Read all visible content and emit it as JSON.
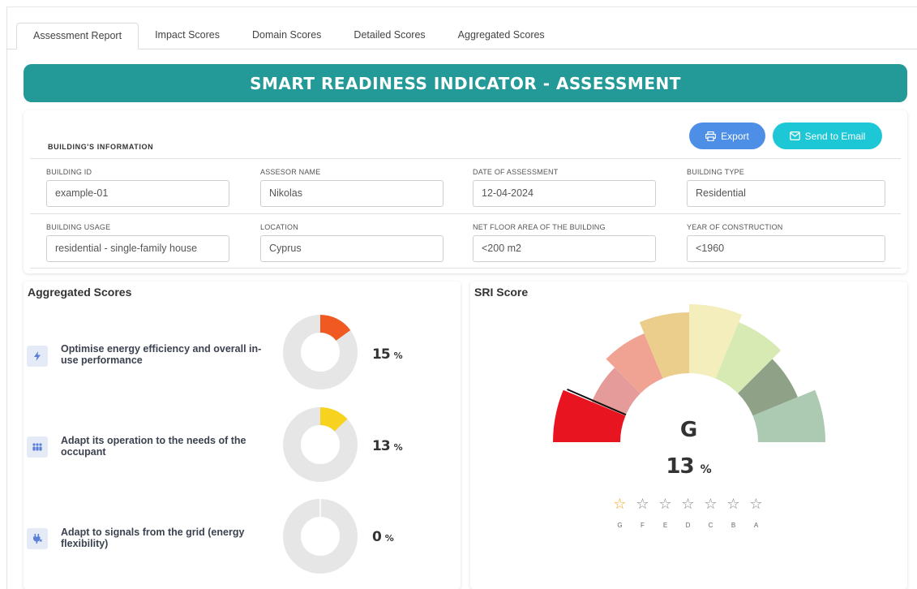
{
  "tabs": [
    "Assessment Report",
    "Impact Scores",
    "Domain Scores",
    "Detailed Scores",
    "Aggregated Scores"
  ],
  "banner": {
    "title": "SMART READINESS INDICATOR - ASSESSMENT",
    "color": "#239a97"
  },
  "building_info": {
    "title": "BUILDING'S INFORMATION",
    "export_label": "Export",
    "email_label": "Send to Email",
    "fields": [
      {
        "label": "BUILDING ID",
        "value": "example-01"
      },
      {
        "label": "ASSESOR NAME",
        "value": "Nikolas"
      },
      {
        "label": "DATE OF ASSESSMENT",
        "value": "12-04-2024"
      },
      {
        "label": "BUILDING TYPE",
        "value": "Residential"
      },
      {
        "label": "BUILDING USAGE",
        "value": "residential - single-family house"
      },
      {
        "label": "LOCATION",
        "value": "Cyprus"
      },
      {
        "label": "NET FLOOR AREA OF THE BUILDING",
        "value": "<200 m2"
      },
      {
        "label": "YEAR OF CONSTRUCTION",
        "value": "<1960"
      }
    ]
  },
  "aggregated": {
    "title": "Aggregated Scores",
    "items": [
      {
        "label": "Optimise energy efficiency and overall in-use performance",
        "value": 15,
        "unit": "%",
        "color": "#f05a22",
        "icon": "lightning-icon"
      },
      {
        "label": "Adapt its operation to the needs of the occupant",
        "value": 13,
        "unit": "%",
        "color": "#f7d320",
        "icon": "people-icon"
      },
      {
        "label": "Adapt to signals from the grid (energy flexibility)",
        "value": 0,
        "unit": "%",
        "color": "#dd6b3a",
        "icon": "plug-icon"
      }
    ]
  },
  "sri": {
    "title": "SRI Score",
    "grade": "G",
    "value": 13,
    "unit": "%",
    "classes": [
      "G",
      "F",
      "E",
      "D",
      "C",
      "B",
      "A"
    ],
    "filled_stars": 1,
    "gauge_colors": [
      "#e8141f",
      "#e49b99",
      "#f0a392",
      "#ebcd8c",
      "#f3eebc",
      "#d8eab3",
      "#8fa287",
      "#acc9b2"
    ]
  }
}
